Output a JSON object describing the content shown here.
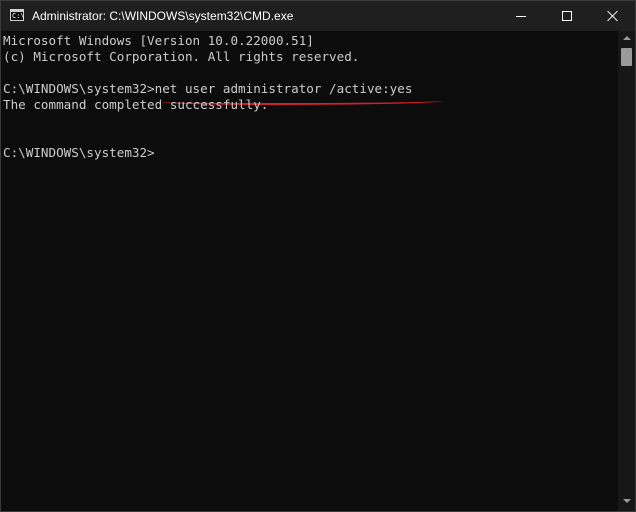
{
  "window": {
    "title": "Administrator: C:\\WINDOWS\\system32\\CMD.exe",
    "icon": "cmd-icon",
    "icon_glyph": "C:\\"
  },
  "controls": {
    "minimize": "minimize-icon",
    "maximize": "maximize-icon",
    "close": "close-icon"
  },
  "console": {
    "lines": [
      "Microsoft Windows [Version 10.0.22000.51]",
      "(c) Microsoft Corporation. All rights reserved.",
      "C:\\WINDOWS\\system32>net user administrator /active:yes",
      "The command completed successfully.",
      "C:\\WINDOWS\\system32>"
    ],
    "text_color": "#cccccc",
    "background": "#0c0c0c",
    "highlight_color": "#d0202a"
  }
}
